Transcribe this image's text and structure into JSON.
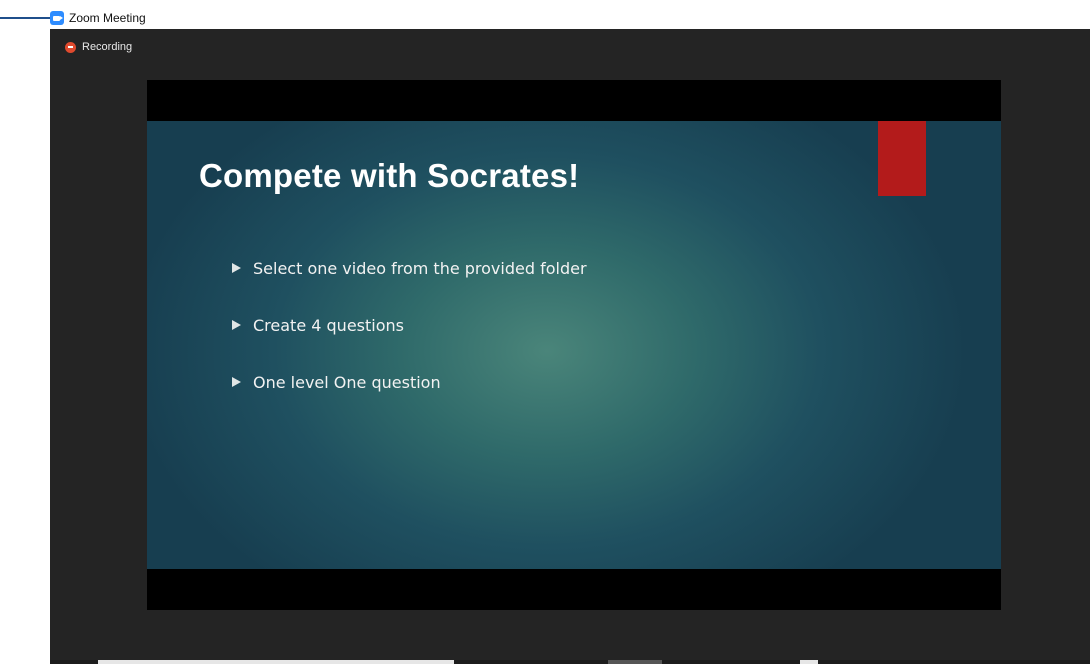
{
  "window": {
    "title": "Zoom Meeting",
    "app_icon": "zoom-video-icon"
  },
  "recording": {
    "label": "Recording",
    "icon": "record-dot-icon",
    "color": "#e04a2e"
  },
  "slide": {
    "title": "Compete with Socrates!",
    "accent_color": "#b31b1b",
    "bullets": [
      {
        "text": "Select one video from the provided folder",
        "icon": "triangle-bullet-icon"
      },
      {
        "text": "Create 4 questions",
        "icon": "triangle-bullet-icon"
      },
      {
        "text": "One level One question",
        "icon": "triangle-bullet-icon"
      }
    ]
  }
}
